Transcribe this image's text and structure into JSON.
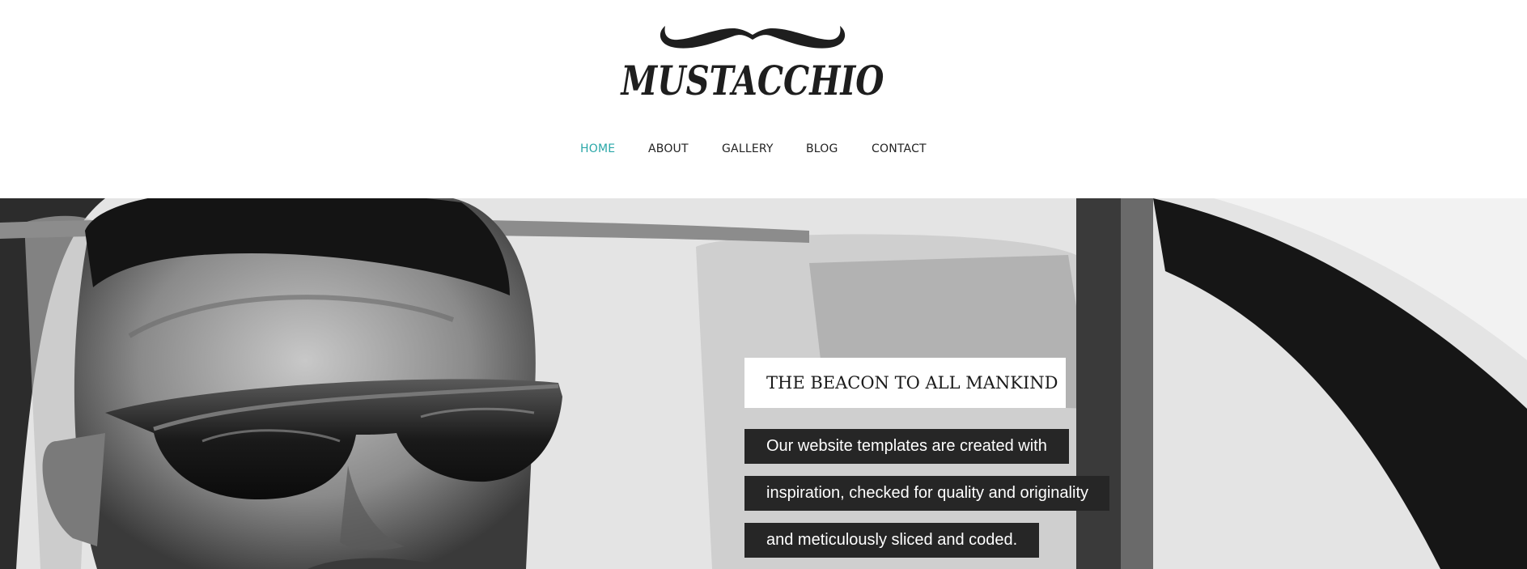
{
  "brand": {
    "name": "MUSTACCHIO",
    "logo_icon": "mustache-icon"
  },
  "nav": {
    "items": [
      {
        "label": "HOME",
        "active": true
      },
      {
        "label": "ABOUT",
        "active": false
      },
      {
        "label": "GALLERY",
        "active": false
      },
      {
        "label": "BLOG",
        "active": false
      },
      {
        "label": "CONTACT",
        "active": false
      }
    ],
    "active_color": "#2aa7a8",
    "text_color": "#222222"
  },
  "hero": {
    "title": "THE BEACON TO ALL MANKIND",
    "lines": [
      "Our website templates are created with",
      "inspiration, checked for quality and originality",
      "and meticulously sliced and coded."
    ]
  }
}
